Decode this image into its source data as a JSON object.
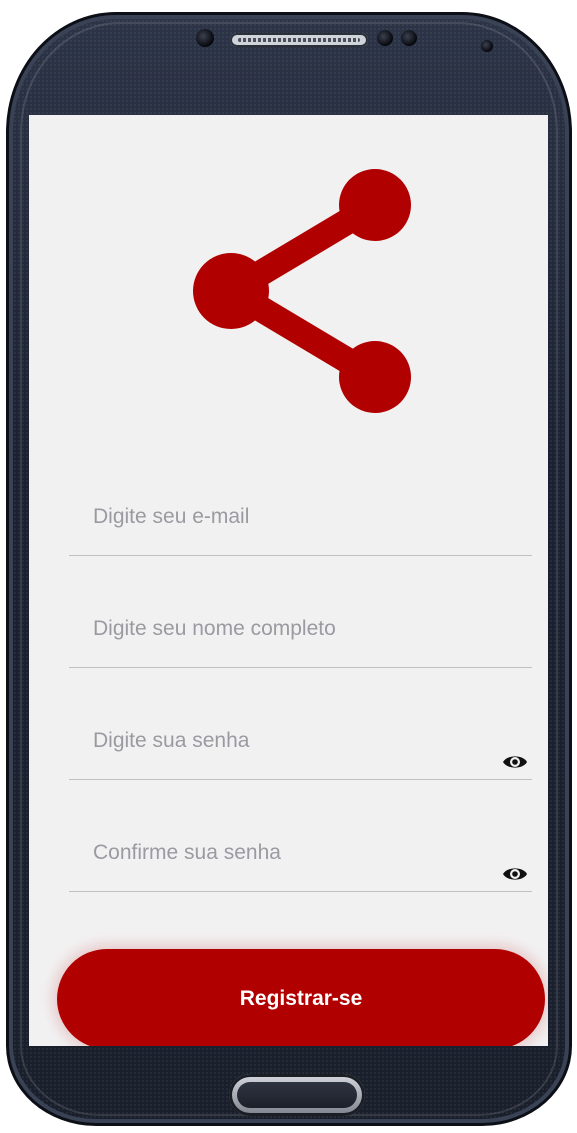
{
  "app": {
    "brand_color": "#b10000",
    "logo_icon": "share-icon"
  },
  "form": {
    "email": {
      "value": "",
      "placeholder": "Digite seu e-mail"
    },
    "full_name": {
      "value": "",
      "placeholder": "Digite seu nome completo"
    },
    "password": {
      "value": "",
      "placeholder": "Digite sua senha",
      "toggle_icon": "eye-icon"
    },
    "confirm_password": {
      "value": "",
      "placeholder": "Confirme sua senha",
      "toggle_icon": "eye-icon"
    }
  },
  "actions": {
    "register_label": "Registrar-se"
  }
}
